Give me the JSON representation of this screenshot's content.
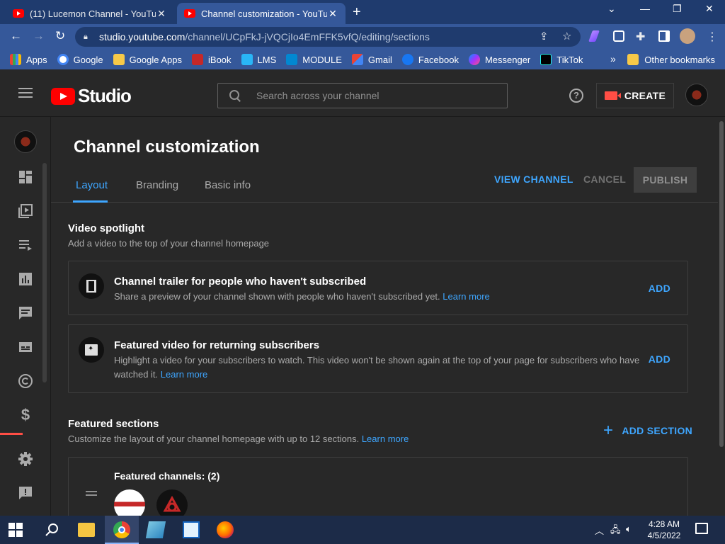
{
  "browser": {
    "tabs": [
      {
        "title": "(11) Lucemon Channel - YouTube",
        "active": false
      },
      {
        "title": "Channel customization - YouTube",
        "active": true
      }
    ],
    "url_host": "studio.youtube.com",
    "url_path": "/channel/UCpFkJ-jVQCjIo4EmFFK5vfQ/editing/sections",
    "bookmarks": [
      "Apps",
      "Google",
      "Google Apps",
      "iBook",
      "LMS",
      "MODULE",
      "Gmail",
      "Facebook",
      "Messenger",
      "TikTok"
    ],
    "other_bookmarks": "Other bookmarks"
  },
  "studio": {
    "logo_text": "Studio",
    "search_placeholder": "Search across your channel",
    "create_label": "CREATE"
  },
  "page": {
    "title": "Channel customization",
    "tabs": [
      {
        "label": "Layout",
        "active": true
      },
      {
        "label": "Branding",
        "active": false
      },
      {
        "label": "Basic info",
        "active": false
      }
    ],
    "view_channel": "VIEW CHANNEL",
    "cancel": "CANCEL",
    "publish": "PUBLISH"
  },
  "spotlight": {
    "title": "Video spotlight",
    "subtitle": "Add a video to the top of your channel homepage",
    "trailer": {
      "title": "Channel trailer for people who haven't subscribed",
      "desc": "Share a preview of your channel shown with people who haven't subscribed yet.",
      "learn_more": "Learn more",
      "add": "ADD"
    },
    "featured": {
      "title": "Featured video for returning subscribers",
      "desc": "Highlight a video for your subscribers to watch. This video won't be shown again at the top of your page for subscribers who have watched it.",
      "learn_more": "Learn more",
      "add": "ADD"
    }
  },
  "featured_sections": {
    "title": "Featured sections",
    "subtitle": "Customize the layout of your channel homepage with up to 12 sections.",
    "learn_more": "Learn more",
    "add_section": "ADD SECTION",
    "card_title": "Featured channels: (2)"
  },
  "taskbar": {
    "time": "4:28 AM",
    "date": "4/5/2022"
  },
  "colors": {
    "accent": "#3ea6ff",
    "youtube_red": "#ff0000",
    "create_red": "#ff4e45",
    "bg": "#282828"
  }
}
